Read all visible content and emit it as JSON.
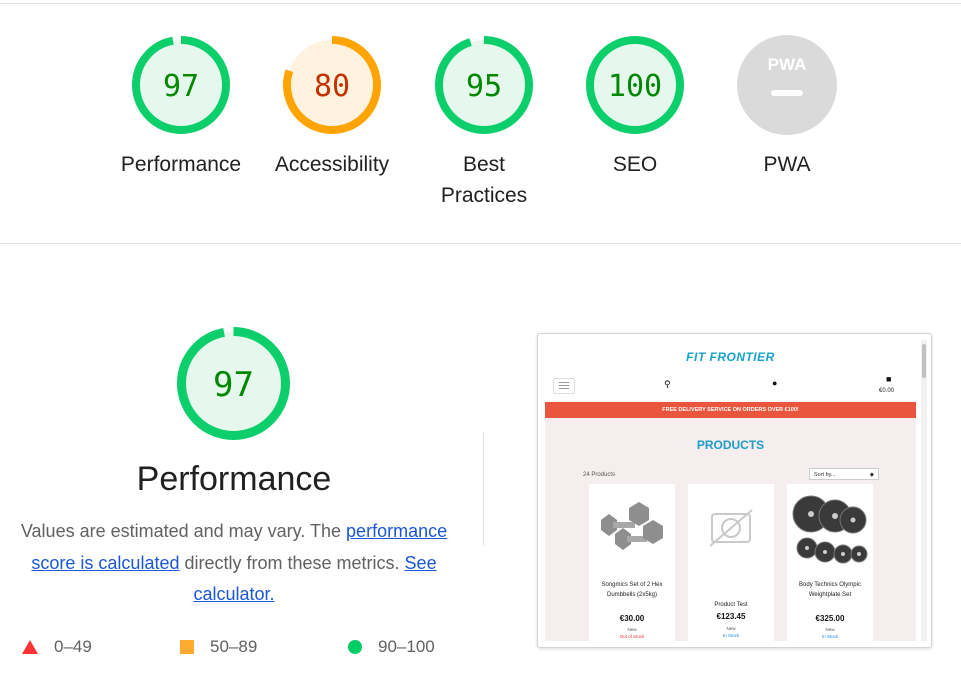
{
  "scores": [
    {
      "label": "Performance",
      "score": "97",
      "value": 97,
      "color": "#0cce6b",
      "bg": "#e6f8ee",
      "text_color": "#008800"
    },
    {
      "label": "Accessibility",
      "score": "80",
      "value": 80,
      "color": "#ffa400",
      "bg": "#fff3e0",
      "text_color": "#c33300"
    },
    {
      "label": "Best Practices",
      "score": "95",
      "value": 95,
      "color": "#0cce6b",
      "bg": "#e6f8ee",
      "text_color": "#008800"
    },
    {
      "label": "SEO",
      "score": "100",
      "value": 100,
      "color": "#0cce6b",
      "bg": "#e6f8ee",
      "text_color": "#008800"
    },
    {
      "label": "PWA",
      "badge": "PWA",
      "color": "#dadada"
    }
  ],
  "detail": {
    "score": "97",
    "value": 97,
    "title": "Performance",
    "desc_part1": "Values are estimated and may vary. The ",
    "desc_link": "performance score is calculated",
    "desc_part2": " directly from these metrics. ",
    "calc_link": "See calculator."
  },
  "legend": [
    {
      "range": "0–49",
      "color": "#ff3333",
      "icon": "triangle-icon"
    },
    {
      "range": "50–89",
      "color": "#ffaa33",
      "icon": "square-icon"
    },
    {
      "range": "90–100",
      "color": "#00cc66",
      "icon": "circle-icon"
    }
  ],
  "screenshot": {
    "brand": "FIT FRONTIER",
    "cart_total": "€0.00",
    "banner": "FREE DELIVERY SERVICE ON ORDERS OVER €100!",
    "heading": "PRODUCTS",
    "count": "24 Products",
    "sort": "Sort by...",
    "products": [
      {
        "name": "Songmics Set of 2 Hex Dumbbells (2x5kg)",
        "price": "€30.00",
        "tag": "New",
        "stock": "Out of Stock",
        "stock_color": "#e53935",
        "image": "dumbbells-image"
      },
      {
        "name": "Product Test",
        "price": "€123.45",
        "tag": "New",
        "stock": "In Stock",
        "stock_color": "#1e88e5",
        "image": "no-image-icon"
      },
      {
        "name": "Body Technics Olympic Weightplate Set",
        "price": "€325.00",
        "tag": "New",
        "stock": "In Stock",
        "stock_color": "#1e88e5",
        "image": "weight-plates-image"
      }
    ]
  }
}
